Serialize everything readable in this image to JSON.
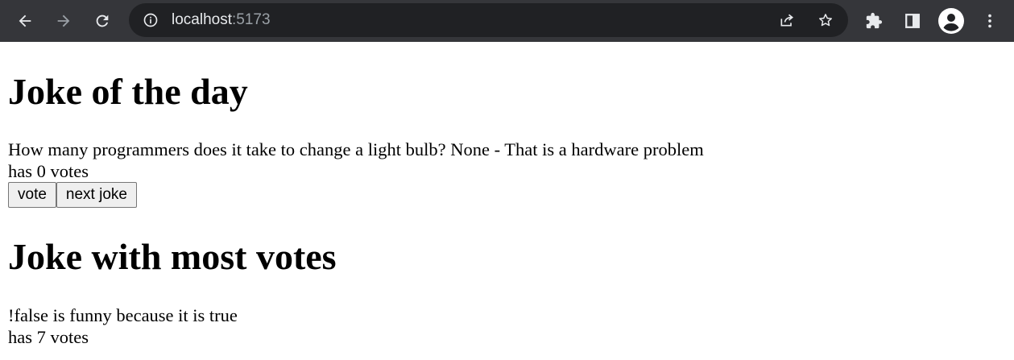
{
  "browser": {
    "url_host": "localhost",
    "url_port": ":5173",
    "icons": {
      "back": "arrow-left-icon",
      "forward": "arrow-right-icon",
      "reload": "reload-icon",
      "site_info": "info-icon",
      "share": "share-icon",
      "bookmark": "star-icon",
      "extensions": "puzzle-icon",
      "side_panel": "side-panel-icon",
      "profile": "profile-icon",
      "menu": "kebab-menu-icon"
    },
    "colors": {
      "toolbar": "#35363a",
      "omnibox": "#202124",
      "icon": "#e8eaed",
      "icon_disabled": "#9aa0a6"
    }
  },
  "joke_of_day": {
    "heading": "Joke of the day",
    "text": "How many programmers does it take to change a light bulb? None - That is a hardware problem",
    "votes": "has 0 votes",
    "vote_button": "vote",
    "next_button": "next joke"
  },
  "most_votes": {
    "heading": "Joke with most votes",
    "text": "!false is funny because it is true",
    "votes": "has 7 votes"
  }
}
